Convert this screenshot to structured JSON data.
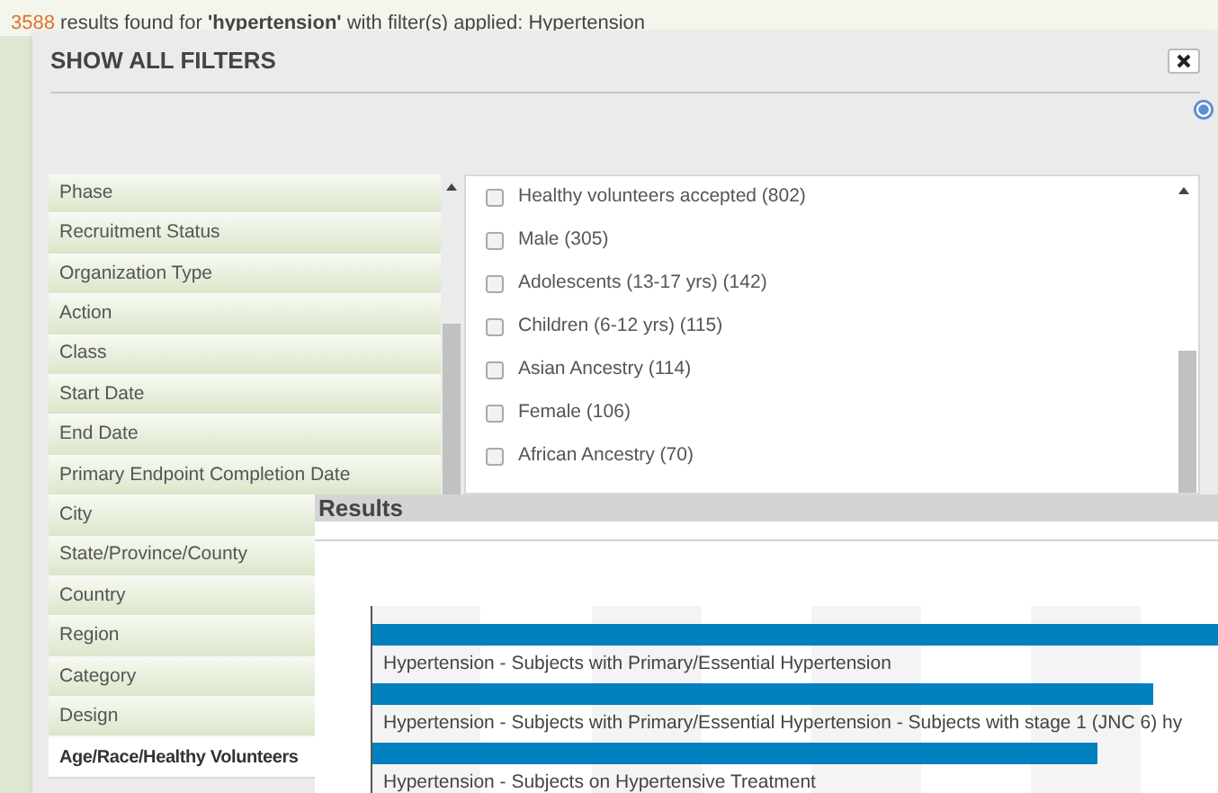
{
  "background": {
    "result_count": "3588",
    "summary": "results found for **'hypertension'** with filter(s) applied:  Hypertension"
  },
  "dialog": {
    "title": "SHOW ALL FILTERS",
    "categories": [
      {
        "label": "Phase",
        "selected": false
      },
      {
        "label": "Recruitment Status",
        "selected": false
      },
      {
        "label": "Organization Type",
        "selected": false
      },
      {
        "label": "Action",
        "selected": false
      },
      {
        "label": "Class",
        "selected": false
      },
      {
        "label": "Start Date",
        "selected": false
      },
      {
        "label": "End Date",
        "selected": false
      },
      {
        "label": "Primary Endpoint Completion Date",
        "selected": false
      },
      {
        "label": "City",
        "selected": false
      },
      {
        "label": "State/Province/County",
        "selected": false
      },
      {
        "label": "Country",
        "selected": false
      },
      {
        "label": "Region",
        "selected": false
      },
      {
        "label": "Category",
        "selected": false
      },
      {
        "label": "Design",
        "selected": false
      },
      {
        "label": "Age/Race/Healthy Volunteers",
        "selected": true
      }
    ],
    "options": [
      {
        "label": "Healthy volunteers accepted (802)",
        "checked": false
      },
      {
        "label": "Male (305)",
        "checked": false
      },
      {
        "label": "Adolescents (13-17 yrs) (142)",
        "checked": false
      },
      {
        "label": "Children (6-12 yrs) (115)",
        "checked": false
      },
      {
        "label": "Asian Ancestry (114)",
        "checked": false
      },
      {
        "label": "Female (106)",
        "checked": false
      },
      {
        "label": "African Ancestry (70)",
        "checked": false
      }
    ]
  },
  "results_panel": {
    "title": "Results",
    "bar_labels": [
      "Hypertension - Subjects with Primary/Essential Hypertension",
      "Hypertension - Subjects with Primary/Essential Hypertension - Subjects with stage 1 (JNC 6) hy",
      "Hypertension - Subjects on Hypertensive Treatment"
    ]
  }
}
